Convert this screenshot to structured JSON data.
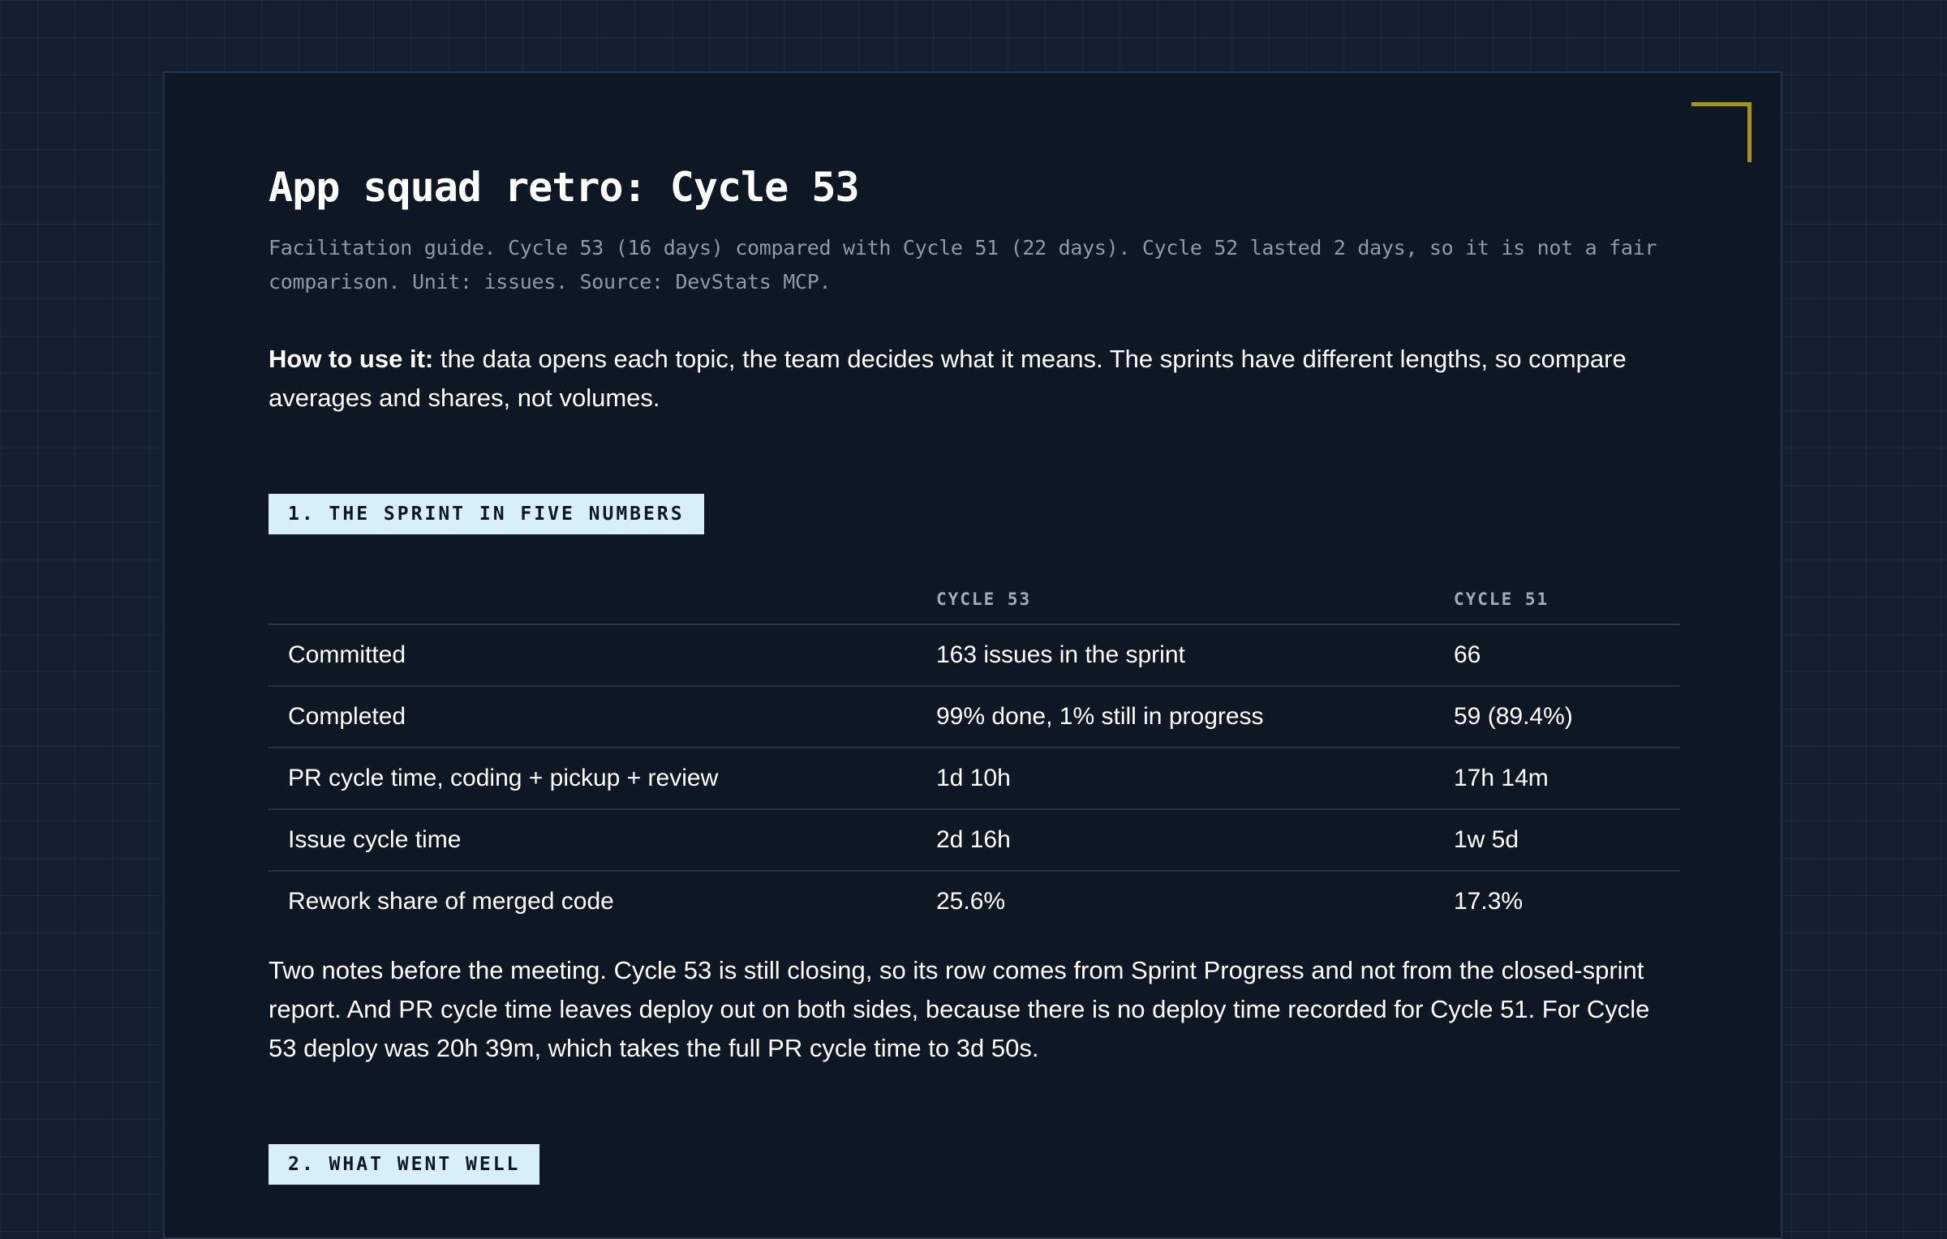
{
  "title": "App squad retro: Cycle 53",
  "subtitle": "Facilitation guide. Cycle 53 (16 days) compared with Cycle 51 (22 days). Cycle 52 lasted 2 days, so it is not a fair comparison. Unit: issues. Source: DevStats MCP.",
  "intro": {
    "label": "How to use it:",
    "text": " the data opens each topic, the team decides what it means. The sprints have different lengths, so compare averages and shares, not volumes."
  },
  "sections": [
    {
      "label": "1. THE SPRINT IN FIVE NUMBERS"
    },
    {
      "label": "2. WHAT WENT WELL"
    }
  ],
  "metrics_table": {
    "headers": [
      "",
      "CYCLE 53",
      "CYCLE 51"
    ],
    "rows": [
      {
        "metric": "Committed",
        "cycle53": "163 issues in the sprint",
        "cycle51": "66"
      },
      {
        "metric": "Completed",
        "cycle53": "99% done, 1% still in progress",
        "cycle51": "59 (89.4%)"
      },
      {
        "metric": "PR cycle time, coding + pickup + review",
        "cycle53": "1d 10h",
        "cycle51": "17h 14m"
      },
      {
        "metric": "Issue cycle time",
        "cycle53": "2d 16h",
        "cycle51": "1w 5d"
      },
      {
        "metric": "Rework share of merged code",
        "cycle53": "25.6%",
        "cycle51": "17.3%"
      }
    ]
  },
  "notes": "Two notes before the meeting. Cycle 53 is still closing, so its row comes from Sprint Progress and not from the closed-sprint report. And PR cycle time leaves deploy out on both sides, because there is no deploy time recorded for Cycle 51. For Cycle 53 deploy was 20h 39m, which takes the full PR cycle time to 3d 50s.",
  "colors": {
    "background": "#13202f",
    "card": "#0e1824",
    "accent_corner": "#a89228",
    "section_tag": "#d8eef9"
  }
}
